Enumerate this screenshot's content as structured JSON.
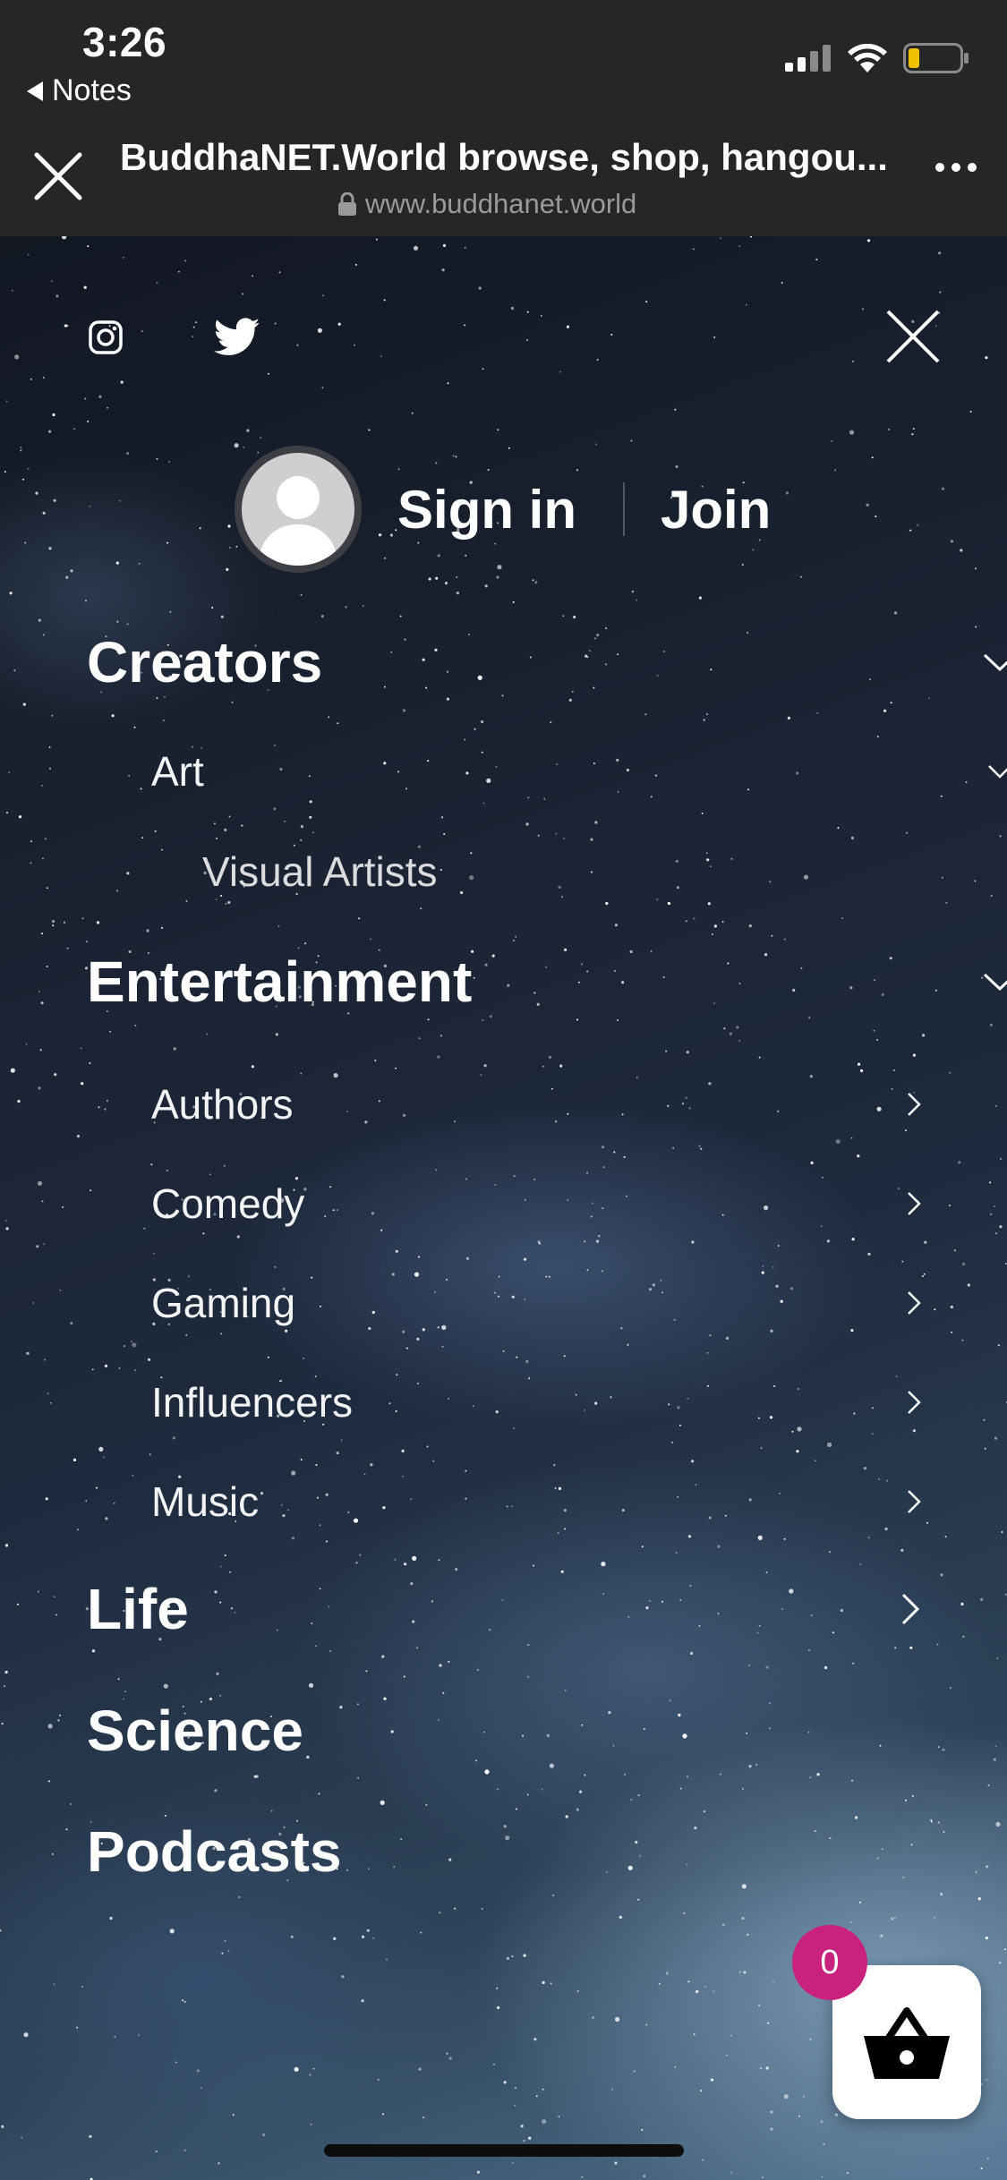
{
  "status_bar": {
    "time": "3:26",
    "back_app": "Notes",
    "icons": [
      "cellular-signal-icon",
      "wifi-icon",
      "battery-low-icon"
    ]
  },
  "browser": {
    "title": "BuddhaNET.World browse, shop, hangou...",
    "url": "www.buddhanet.world",
    "icons": [
      "close-icon",
      "lock-icon",
      "more-icon"
    ]
  },
  "menu": {
    "social": [
      "instagram-icon",
      "twitter-icon"
    ],
    "auth": {
      "sign_in": "Sign in",
      "join": "Join"
    },
    "items": [
      {
        "label": "Creators",
        "level": 1,
        "indicator": "chevron-down"
      },
      {
        "label": "Art",
        "level": 2,
        "indicator": "chevron-down"
      },
      {
        "label": "Visual Artists",
        "level": 3,
        "indicator": "none"
      },
      {
        "label": "Entertainment",
        "level": 1,
        "indicator": "chevron-down"
      },
      {
        "label": "Authors",
        "level": 2,
        "indicator": "chevron-right"
      },
      {
        "label": "Comedy",
        "level": 2,
        "indicator": "chevron-right"
      },
      {
        "label": "Gaming",
        "level": 2,
        "indicator": "chevron-right"
      },
      {
        "label": "Influencers",
        "level": 2,
        "indicator": "chevron-right"
      },
      {
        "label": "Music",
        "level": 2,
        "indicator": "chevron-right"
      },
      {
        "label": "Life",
        "level": 1,
        "indicator": "chevron-right"
      },
      {
        "label": "Science",
        "level": 1,
        "indicator": "none"
      },
      {
        "label": "Podcasts",
        "level": 1,
        "indicator": "none"
      }
    ]
  },
  "cart": {
    "count": "0"
  },
  "colors": {
    "browser_chrome": "#262626",
    "cart_badge": "#c8217e",
    "url_text": "#9a9a9a"
  }
}
